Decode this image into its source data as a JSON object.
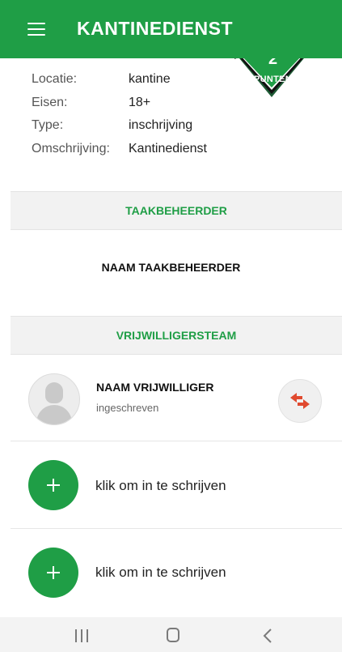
{
  "header": {
    "title": "KANTINEDIENST",
    "menu_icon": "hamburger-menu-icon",
    "background": "#1f9e46"
  },
  "badge": {
    "number": "2",
    "label": "PUNTEN"
  },
  "details": [
    {
      "key": "Locatie:",
      "value": "kantine"
    },
    {
      "key": "Eisen:",
      "value": "18+"
    },
    {
      "key": "Type:",
      "value": "inschrijving"
    },
    {
      "key": "Omschrijving:",
      "value": "Kantinedienst"
    }
  ],
  "sections": {
    "manager_header": "TAAKBEHEERDER",
    "manager_name": "NAAM TAAKBEHEERDER",
    "team_header": "VRIJWILLIGERSTEAM"
  },
  "volunteer": {
    "name": "NAAM VRIJWILLIGER",
    "status": "ingeschreven",
    "swap_icon": "swap-arrows-icon"
  },
  "signup_slots": [
    {
      "label": "klik om in te schrijven"
    },
    {
      "label": "klik om in te schrijven"
    }
  ],
  "colors": {
    "accent": "#1f9e46",
    "swap": "#e04a2f"
  }
}
